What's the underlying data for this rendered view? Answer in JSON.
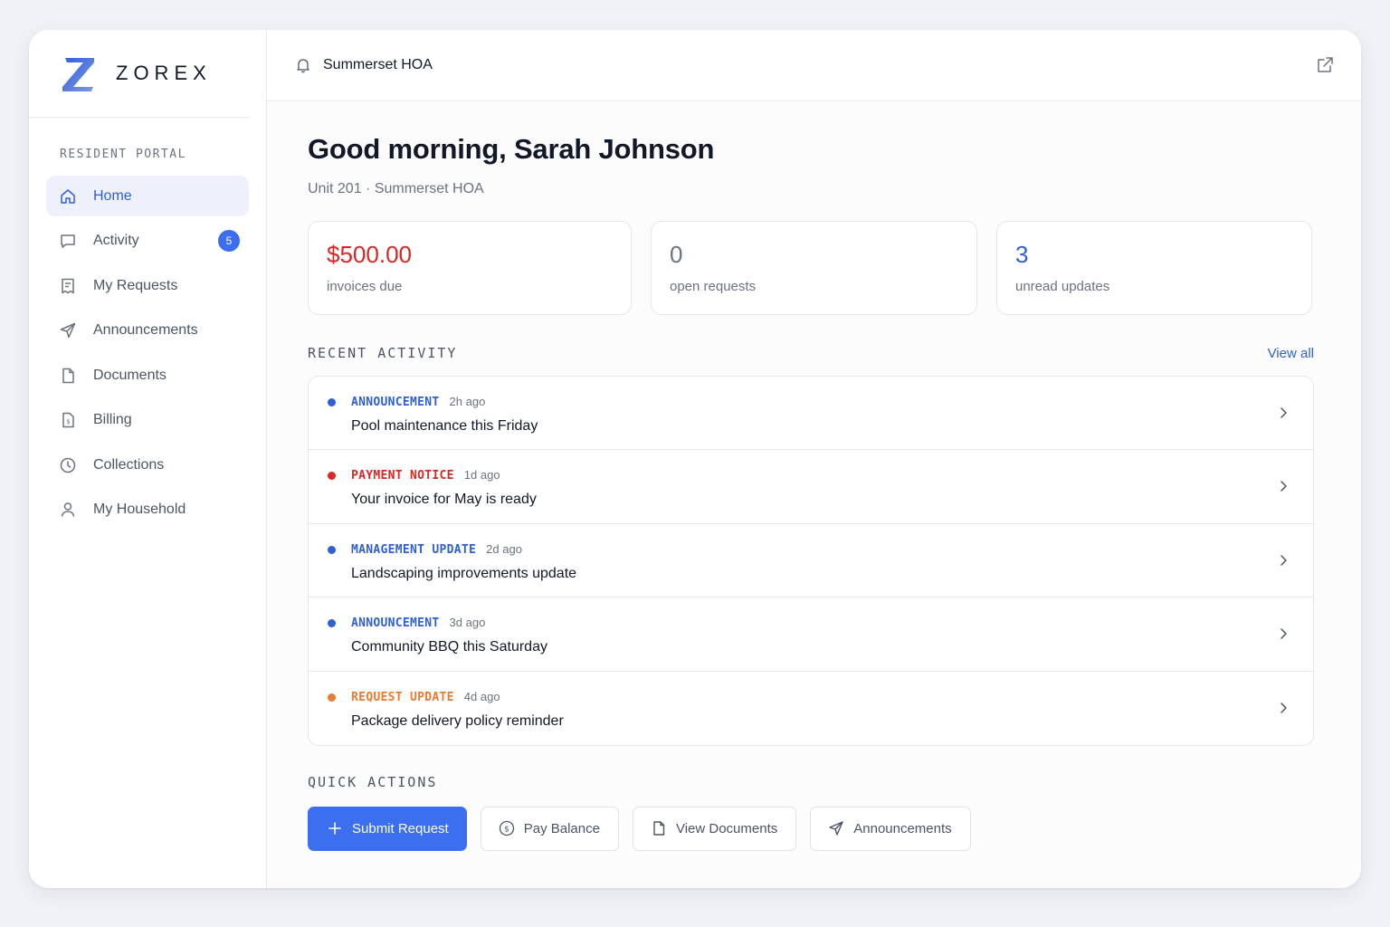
{
  "brand": {
    "name": "ZOREX"
  },
  "sidebar": {
    "section_label": "RESIDENT PORTAL",
    "items": [
      {
        "label": "Home",
        "icon": "home-icon",
        "active": true
      },
      {
        "label": "Activity",
        "icon": "chat-icon",
        "badge": "5"
      },
      {
        "label": "My Requests",
        "icon": "receipt-icon"
      },
      {
        "label": "Announcements",
        "icon": "send-icon"
      },
      {
        "label": "Documents",
        "icon": "document-icon"
      },
      {
        "label": "Billing",
        "icon": "billing-icon"
      },
      {
        "label": "Collections",
        "icon": "clock-icon"
      },
      {
        "label": "My Household",
        "icon": "user-icon"
      }
    ]
  },
  "topbar": {
    "org": "Summerset HOA",
    "bell_icon": "bell-icon",
    "external_icon": "external-link-icon"
  },
  "main": {
    "greeting": "Good morning, Sarah Johnson",
    "subline": "Unit 201 · Summerset HOA",
    "stats": [
      {
        "value": "$500.00",
        "label": "invoices due",
        "color": "#dc2626"
      },
      {
        "value": "0",
        "label": "open requests",
        "color": "#6b7280"
      },
      {
        "value": "3",
        "label": "unread updates",
        "color": "#2f5fd8"
      }
    ],
    "recent_activity": {
      "title": "RECENT ACTIVITY",
      "view_all": "View all",
      "items": [
        {
          "type": "ANNOUNCEMENT",
          "time": "2h ago",
          "title": "Pool maintenance this Friday",
          "color": "#2f5fd8"
        },
        {
          "type": "PAYMENT NOTICE",
          "time": "1d ago",
          "title": "Your invoice for May is ready",
          "color": "#dc2626"
        },
        {
          "type": "MANAGEMENT UPDATE",
          "time": "2d ago",
          "title": "Landscaping improvements update",
          "color": "#2f5fd8"
        },
        {
          "type": "ANNOUNCEMENT",
          "time": "3d ago",
          "title": "Community BBQ this Saturday",
          "color": "#2f5fd8"
        },
        {
          "type": "REQUEST UPDATE",
          "time": "4d ago",
          "title": "Package delivery policy reminder",
          "color": "#ea7a2f"
        }
      ]
    },
    "quick_actions": {
      "title": "QUICK ACTIONS",
      "buttons": [
        {
          "label": "Submit Request",
          "icon": "plus-icon"
        },
        {
          "label": "Pay Balance",
          "icon": "dollar-circle-icon"
        },
        {
          "label": "View Documents",
          "icon": "document-icon"
        },
        {
          "label": "Announcements",
          "icon": "send-icon"
        }
      ]
    }
  }
}
